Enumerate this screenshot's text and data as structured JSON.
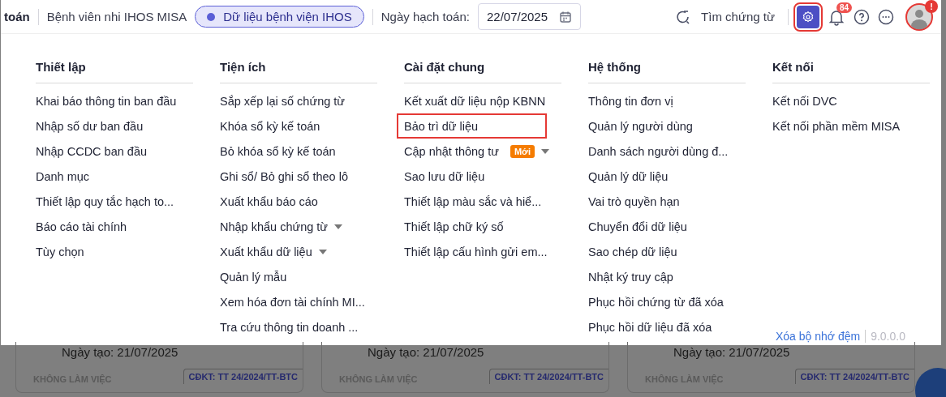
{
  "header": {
    "app_title_fragment": "toán",
    "unit_name": "Bệnh viên nhi IHOS MISA",
    "data_chip": "Dữ liệu bệnh viện IHOS",
    "date_label": "Ngày hạch toán:",
    "date_value": "22/07/2025",
    "search_label": "Tìm chứng từ",
    "settings_highlighted": true,
    "notification_count": "84",
    "avatar_alert": "!"
  },
  "menu": {
    "columns": [
      {
        "title": "Thiết lập",
        "items": [
          {
            "label": "Khai báo thông tin ban đầu",
            "kind": "plain",
            "highlighted": false
          },
          {
            "label": "Nhập số dư ban đầu",
            "kind": "plain",
            "highlighted": false
          },
          {
            "label": "Nhập CCDC ban đầu",
            "kind": "plain",
            "highlighted": false
          },
          {
            "label": "Danh mục",
            "kind": "plain",
            "highlighted": false
          },
          {
            "label": "Thiết lập quy tắc hạch to...",
            "kind": "plain",
            "highlighted": false
          },
          {
            "label": "Báo cáo tài chính",
            "kind": "plain",
            "highlighted": false
          },
          {
            "label": "Tùy chọn",
            "kind": "plain",
            "highlighted": false
          }
        ]
      },
      {
        "title": "Tiện ích",
        "items": [
          {
            "label": "Sắp xếp lại số chứng từ",
            "kind": "plain",
            "highlighted": false
          },
          {
            "label": "Khóa sổ kỳ kế toán",
            "kind": "plain",
            "highlighted": false
          },
          {
            "label": "Bỏ khóa sổ kỳ kế toán",
            "kind": "plain",
            "highlighted": false
          },
          {
            "label": "Ghi sổ/ Bỏ ghi sổ theo lô",
            "kind": "plain",
            "highlighted": false
          },
          {
            "label": "Xuất khẩu báo cáo",
            "kind": "plain",
            "highlighted": false
          },
          {
            "label": "Nhập khẩu chứng từ",
            "kind": "dropdown",
            "highlighted": false
          },
          {
            "label": "Xuất khẩu dữ liệu",
            "kind": "dropdown",
            "highlighted": false
          },
          {
            "label": "Quản lý mẫu",
            "kind": "plain",
            "highlighted": false
          },
          {
            "label": "Xem hóa đơn tài chính MI...",
            "kind": "plain",
            "highlighted": false
          },
          {
            "label": "Tra cứu thông tin doanh ...",
            "kind": "plain",
            "highlighted": false
          }
        ]
      },
      {
        "title": "Cài đặt chung",
        "items": [
          {
            "label": "Kết xuất dữ liệu nộp KBNN",
            "kind": "plain",
            "highlighted": false
          },
          {
            "label": "Bảo trì dữ liệu",
            "kind": "plain",
            "highlighted": true
          },
          {
            "label": "Cập nhật thông tư",
            "kind": "new_dropdown",
            "badge": "Mới",
            "highlighted": false
          },
          {
            "label": "Sao lưu dữ liệu",
            "kind": "plain",
            "highlighted": false
          },
          {
            "label": "Thiết lập màu sắc và hiể...",
            "kind": "plain",
            "highlighted": false
          },
          {
            "label": "Thiết lập chữ ký số",
            "kind": "plain",
            "highlighted": false
          },
          {
            "label": "Thiết lập cấu hình gửi em...",
            "kind": "plain",
            "highlighted": false
          }
        ]
      },
      {
        "title": "Hệ thống",
        "items": [
          {
            "label": "Thông tin đơn vị",
            "kind": "plain",
            "highlighted": false
          },
          {
            "label": "Quản lý người dùng",
            "kind": "plain",
            "highlighted": false
          },
          {
            "label": "Danh sách người dùng đ...",
            "kind": "plain",
            "highlighted": false
          },
          {
            "label": "Quản lý dữ liệu",
            "kind": "plain",
            "highlighted": false
          },
          {
            "label": "Vai trò quyền hạn",
            "kind": "plain",
            "highlighted": false
          },
          {
            "label": "Chuyển đổi dữ liệu",
            "kind": "plain",
            "highlighted": false
          },
          {
            "label": "Sao chép dữ liệu",
            "kind": "plain",
            "highlighted": false
          },
          {
            "label": "Nhật ký truy cập",
            "kind": "plain",
            "highlighted": false
          },
          {
            "label": "Phục hồi chứng từ đã xóa",
            "kind": "plain",
            "highlighted": false
          },
          {
            "label": "Phục hồi dữ liệu đã xóa",
            "kind": "plain",
            "highlighted": false
          }
        ]
      },
      {
        "title": "Kết nối",
        "items": [
          {
            "label": "Kết nối DVC",
            "kind": "plain",
            "highlighted": false
          },
          {
            "label": "Kết nối phần mềm MISA",
            "kind": "plain",
            "highlighted": false
          }
        ]
      }
    ],
    "clear_cache": "Xóa bộ nhớ đệm",
    "version": "9.0.0.0"
  },
  "cards": [
    {
      "created": "Ngày tạo: 21/07/2025",
      "status": "KHÔNG LÀM VIỆC",
      "regime": "CĐKT: TT 24/2024/TT-BTC"
    },
    {
      "created": "Ngày tạo: 21/07/2025",
      "status": "KHÔNG LÀM VIỆC",
      "regime": "CĐKT: TT 24/2024/TT-BTC"
    },
    {
      "created": "Ngày tạo: 21/07/2025",
      "status": "KHÔNG LÀM VIỆC",
      "regime": "CĐKT: TT 24/2024/TT-BTC"
    }
  ]
}
